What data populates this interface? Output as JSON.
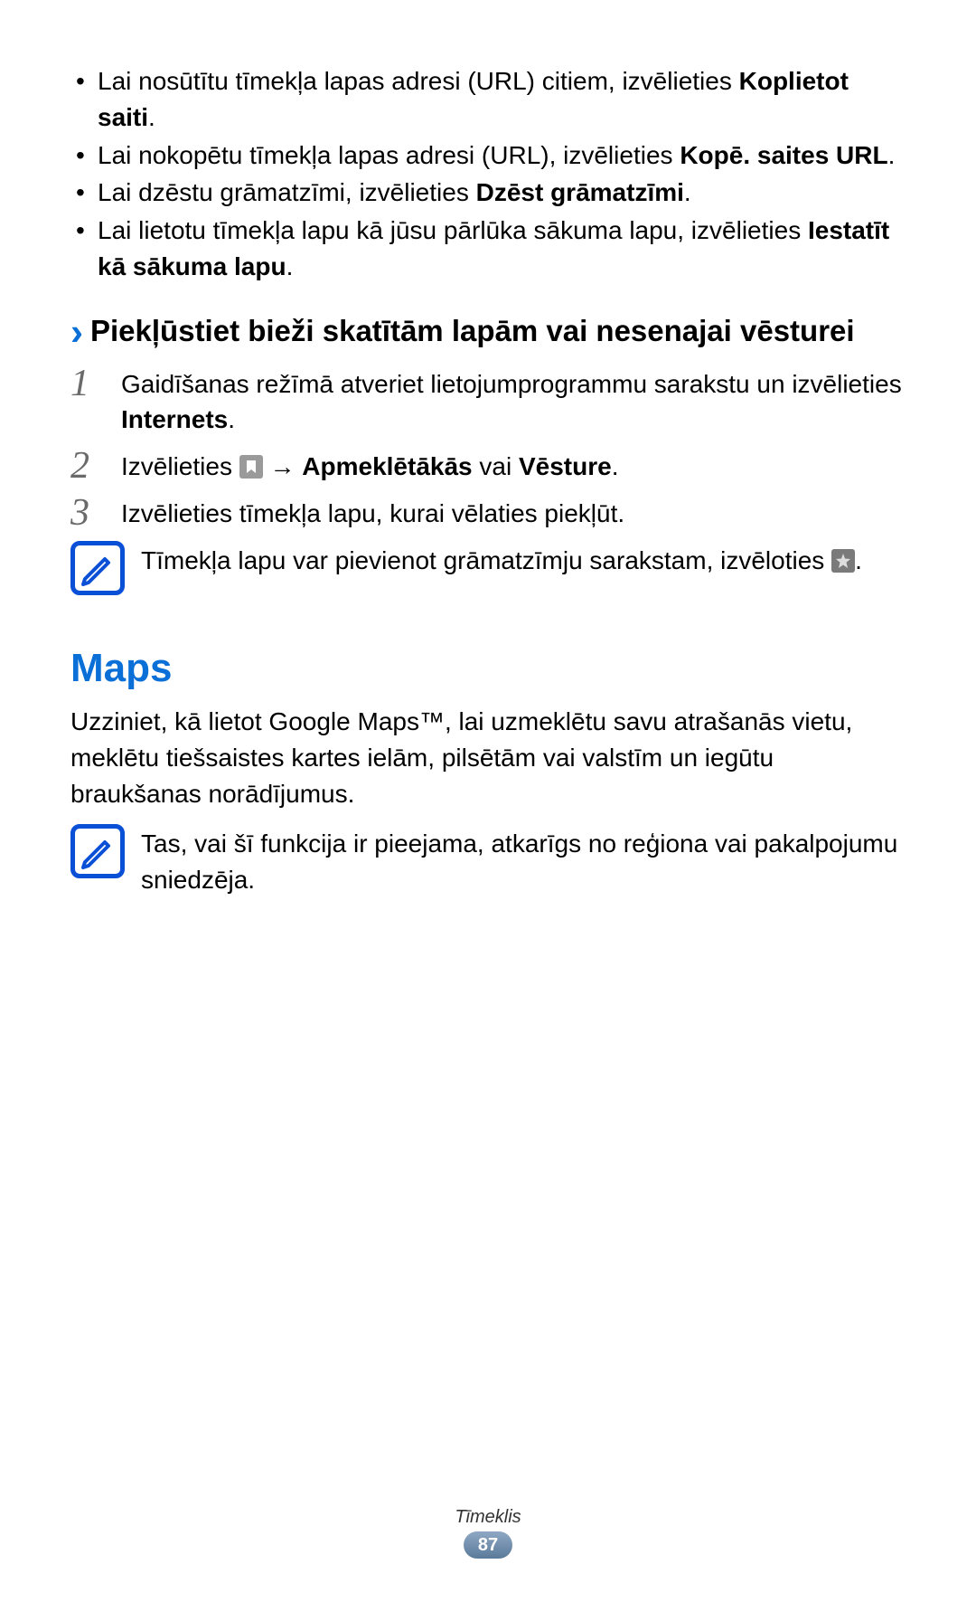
{
  "bullets": [
    {
      "pre": "Lai nosūtītu tīmekļa lapas adresi (URL) citiem, izvēlieties ",
      "bold": "Koplietot saiti",
      "post": "."
    },
    {
      "pre": "Lai nokopētu tīmekļa lapas adresi (URL), izvēlieties ",
      "bold": "Kopē. saites URL",
      "post": "."
    },
    {
      "pre": "Lai dzēstu grāmatzīmi, izvēlieties ",
      "bold": "Dzēst grāmatzīmi",
      "post": "."
    },
    {
      "pre": "Lai lietotu tīmekļa lapu kā jūsu pārlūka sākuma lapu, izvēlieties ",
      "bold": "Iestatīt kā sākuma lapu",
      "post": "."
    }
  ],
  "section_heading": "Piekļūstiet bieži skatītām lapām vai nesenajai vēsturei",
  "steps": {
    "s1": {
      "num": "1",
      "pre": "Gaidīšanas režīmā atveriet lietojumprogrammu sarakstu un izvēlieties ",
      "bold": "Internets",
      "post": "."
    },
    "s2": {
      "num": "2",
      "pre": "Izvēlieties ",
      "arrow": " → ",
      "bold1": "Apmeklētākās",
      "mid": " vai ",
      "bold2": "Vēsture",
      "post": "."
    },
    "s3": {
      "num": "3",
      "text": "Izvēlieties tīmekļa lapu, kurai vēlaties piekļūt."
    }
  },
  "note1": {
    "pre": "Tīmekļa lapu var pievienot grāmatzīmju sarakstam, izvēloties ",
    "post": "."
  },
  "maps_title": "Maps",
  "maps_para": "Uzziniet, kā lietot Google Maps™, lai uzmeklētu savu atrašanās vietu, meklētu tiešsaistes kartes ielām, pilsētām vai valstīm un iegūtu braukšanas norādījumus.",
  "note2": "Tas, vai šī funkcija ir pieejama, atkarīgs no reģiona vai pakalpojumu sniedzēja.",
  "footer_label": "Tīmeklis",
  "footer_num": "87"
}
